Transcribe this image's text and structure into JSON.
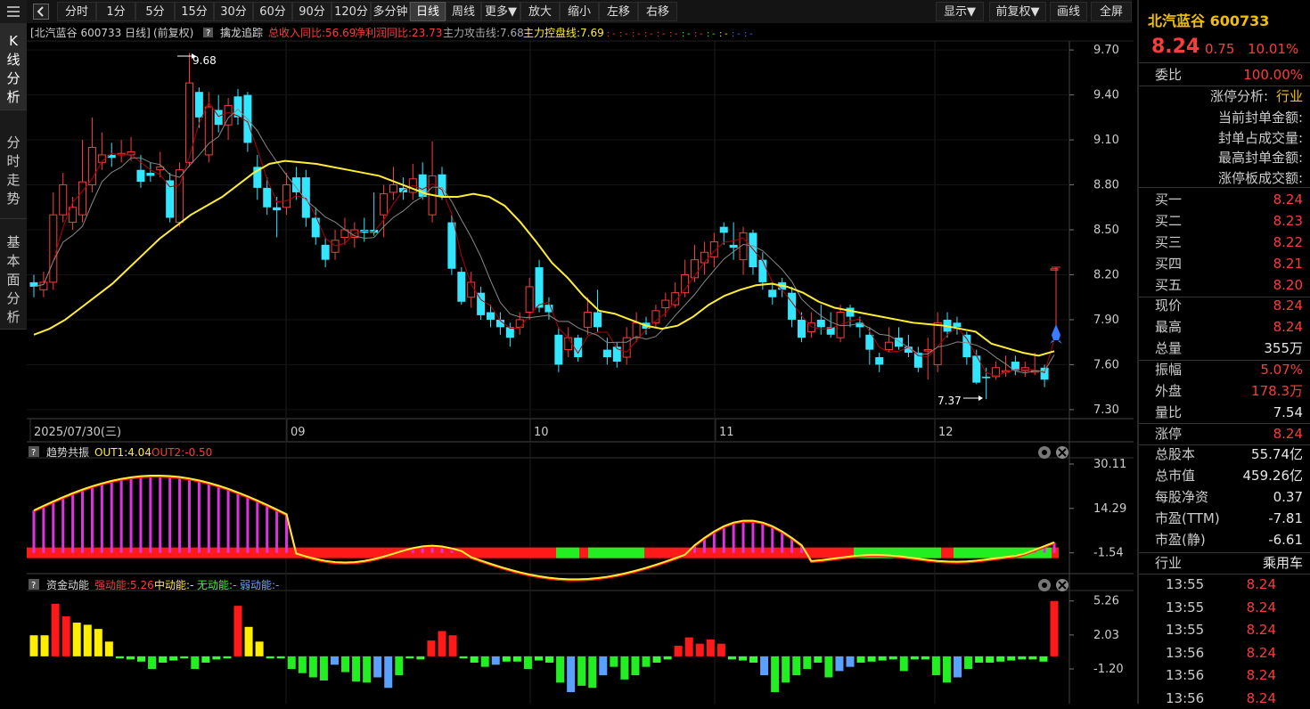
{
  "toolbar": {
    "buttons": [
      "分时",
      "1分",
      "5分",
      "15分",
      "30分",
      "60分",
      "90分",
      "120分",
      "多分钟",
      "日线",
      "周线",
      "更多▼",
      "放大",
      "缩小",
      "左移",
      "右移"
    ],
    "right_buttons": [
      "显示▼",
      "前复权▼",
      "画线",
      "全屏"
    ]
  },
  "left_tabs": [
    "K线分析",
    "分时走势",
    "基本面分析"
  ],
  "chart": {
    "header": {
      "name": "[北汽蓝谷 600733 日线]",
      "adj": "(前复权)",
      "tool": "擒龙追踪",
      "revenue": "总收入同比:56.69",
      "profit": "净利润同比:23.73",
      "attack": "主力攻击线:7.68",
      "control": "主力控盘线:7.69"
    },
    "y_ticks": [
      "9.70",
      "9.40",
      "9.10",
      "8.80",
      "8.50",
      "8.20",
      "7.90",
      "7.60",
      "7.30"
    ],
    "x_labels": [
      "2025/07/30(三)",
      "09",
      "10",
      "11",
      "12"
    ],
    "high_label": "9.68",
    "low_label": "7.37",
    "colors": {
      "up": "#ff3b3b",
      "down": "#33e6ff",
      "ma_short": "#b30000",
      "ma_mid": "#888888",
      "ma_long": "#ffee33"
    }
  },
  "chart_data": {
    "type": "candlestick",
    "y_range": [
      7.24,
      9.76
    ],
    "candles": [
      [
        8.15,
        8.12,
        8.2,
        8.05
      ],
      [
        8.1,
        8.15,
        8.22,
        8.05
      ],
      [
        8.15,
        8.6,
        8.75,
        8.1
      ],
      [
        8.6,
        8.8,
        8.88,
        8.55
      ],
      [
        8.55,
        8.65,
        8.72,
        8.5
      ],
      [
        8.6,
        8.82,
        9.1,
        8.55
      ],
      [
        8.8,
        9.05,
        9.25,
        8.75
      ],
      [
        8.95,
        9.0,
        9.15,
        8.9
      ],
      [
        9.0,
        8.98,
        9.08,
        8.92
      ],
      [
        9.0,
        9.01,
        9.1,
        8.95
      ],
      [
        9.0,
        9.02,
        9.12,
        8.96
      ],
      [
        8.9,
        8.82,
        9.0,
        8.78
      ],
      [
        8.88,
        8.86,
        8.95,
        8.82
      ],
      [
        8.9,
        8.92,
        9.02,
        8.85
      ],
      [
        8.83,
        8.58,
        8.88,
        8.55
      ],
      [
        8.55,
        8.9,
        8.95,
        8.52
      ],
      [
        8.95,
        9.48,
        9.68,
        8.92
      ],
      [
        9.42,
        9.25,
        9.45,
        9.18
      ],
      [
        9.0,
        9.32,
        9.42,
        8.95
      ],
      [
        9.3,
        9.2,
        9.4,
        9.15
      ],
      [
        9.2,
        9.33,
        9.38,
        9.1
      ],
      [
        9.39,
        9.25,
        9.44,
        9.2
      ],
      [
        9.4,
        9.08,
        9.42,
        9.02
      ],
      [
        8.92,
        8.78,
        9.0,
        8.7
      ],
      [
        8.78,
        8.65,
        8.85,
        8.6
      ],
      [
        8.65,
        8.63,
        8.72,
        8.45
      ],
      [
        8.65,
        8.8,
        8.88,
        8.6
      ],
      [
        8.85,
        8.75,
        8.92,
        8.7
      ],
      [
        8.85,
        8.58,
        8.9,
        8.52
      ],
      [
        8.58,
        8.45,
        8.65,
        8.4
      ],
      [
        8.4,
        8.3,
        8.45,
        8.25
      ],
      [
        8.35,
        8.43,
        8.5,
        8.3
      ],
      [
        8.45,
        8.5,
        8.58,
        8.4
      ],
      [
        8.45,
        8.5,
        8.55,
        8.38
      ],
      [
        8.5,
        8.48,
        8.58,
        8.42
      ],
      [
        8.5,
        8.48,
        8.75,
        8.46
      ],
      [
        8.6,
        8.74,
        8.8,
        8.45
      ],
      [
        8.75,
        8.8,
        8.92,
        8.7
      ],
      [
        8.78,
        8.75,
        8.85,
        8.7
      ],
      [
        8.75,
        8.84,
        8.94,
        8.7
      ],
      [
        8.87,
        8.72,
        8.95,
        8.7
      ],
      [
        8.6,
        8.86,
        9.09,
        8.55
      ],
      [
        8.87,
        8.72,
        8.92,
        8.7
      ],
      [
        8.55,
        8.24,
        8.6,
        8.2
      ],
      [
        8.22,
        8.02,
        8.25,
        8.0
      ],
      [
        8.05,
        8.15,
        8.22,
        7.98
      ],
      [
        8.08,
        7.93,
        8.12,
        7.9
      ],
      [
        7.95,
        7.9,
        8.0,
        7.85
      ],
      [
        7.9,
        7.85,
        7.95,
        7.8
      ],
      [
        7.85,
        7.78,
        7.88,
        7.72
      ],
      [
        7.85,
        7.9,
        7.95,
        7.8
      ],
      [
        7.95,
        8.12,
        8.18,
        7.9
      ],
      [
        8.25,
        7.98,
        8.3,
        7.95
      ],
      [
        8.0,
        7.95,
        8.05,
        7.9
      ],
      [
        7.8,
        7.6,
        7.85,
        7.55
      ],
      [
        7.7,
        7.78,
        7.85,
        7.65
      ],
      [
        7.78,
        7.65,
        7.8,
        7.62
      ],
      [
        7.85,
        7.95,
        8.05,
        7.8
      ],
      [
        7.95,
        7.85,
        8.1,
        7.82
      ],
      [
        7.7,
        7.65,
        7.78,
        7.6
      ],
      [
        7.72,
        7.62,
        7.75,
        7.58
      ],
      [
        7.65,
        7.78,
        7.85,
        7.6
      ],
      [
        7.78,
        7.88,
        7.95,
        7.75
      ],
      [
        7.88,
        7.84,
        7.92,
        7.8
      ],
      [
        7.88,
        7.96,
        8.0,
        7.85
      ],
      [
        7.98,
        8.03,
        8.08,
        7.92
      ],
      [
        8.0,
        8.08,
        8.15,
        7.98
      ],
      [
        8.08,
        8.2,
        8.3,
        8.05
      ],
      [
        8.18,
        8.3,
        8.4,
        8.15
      ],
      [
        8.28,
        8.35,
        8.42,
        8.2
      ],
      [
        8.32,
        8.42,
        8.48,
        8.25
      ],
      [
        8.52,
        8.48,
        8.55,
        8.4
      ],
      [
        8.4,
        8.38,
        8.55,
        8.3
      ],
      [
        8.3,
        8.48,
        8.52,
        8.2
      ],
      [
        8.48,
        8.25,
        8.5,
        8.2
      ],
      [
        8.3,
        8.15,
        8.35,
        8.1
      ],
      [
        8.1,
        8.05,
        8.15,
        8.0
      ],
      [
        8.15,
        8.1,
        8.18,
        8.05
      ],
      [
        8.08,
        7.9,
        8.12,
        7.85
      ],
      [
        7.9,
        7.78,
        7.95,
        7.75
      ],
      [
        7.82,
        7.88,
        7.95,
        7.78
      ],
      [
        7.9,
        7.85,
        8.0,
        7.8
      ],
      [
        7.85,
        7.8,
        7.95,
        7.78
      ],
      [
        7.78,
        7.95,
        8.0,
        7.75
      ],
      [
        7.98,
        7.92,
        8.0,
        7.85
      ],
      [
        7.88,
        7.85,
        7.92,
        7.78
      ],
      [
        7.8,
        7.7,
        7.85,
        7.6
      ],
      [
        7.65,
        7.6,
        7.68,
        7.55
      ],
      [
        7.7,
        7.75,
        7.85,
        7.68
      ],
      [
        7.78,
        7.72,
        7.85,
        7.7
      ],
      [
        7.72,
        7.68,
        7.8,
        7.65
      ],
      [
        7.68,
        7.58,
        7.72,
        7.55
      ],
      [
        7.7,
        7.7,
        7.78,
        7.5
      ],
      [
        7.6,
        7.88,
        7.95,
        7.55
      ],
      [
        7.9,
        7.82,
        7.95,
        7.78
      ],
      [
        7.88,
        7.85,
        7.92,
        7.8
      ],
      [
        7.8,
        7.65,
        7.82,
        7.6
      ],
      [
        7.66,
        7.48,
        7.7,
        7.47
      ],
      [
        7.52,
        7.51,
        7.58,
        7.37
      ],
      [
        7.52,
        7.58,
        7.62,
        7.5
      ],
      [
        7.55,
        7.56,
        7.66,
        7.52
      ],
      [
        7.62,
        7.56,
        7.66,
        7.53
      ],
      [
        7.56,
        7.58,
        7.62,
        7.52
      ],
      [
        7.55,
        7.56,
        7.68,
        7.53
      ],
      [
        7.58,
        7.5,
        7.6,
        7.45
      ],
      [
        8.24,
        8.24,
        8.24,
        8.24
      ]
    ],
    "ma_long_points": [
      7.8,
      7.84,
      7.9,
      7.98,
      8.06,
      8.14,
      8.24,
      8.34,
      8.44,
      8.52,
      8.6,
      8.66,
      8.72,
      8.8,
      8.88,
      8.94,
      8.96,
      8.95,
      8.94,
      8.92,
      8.9,
      8.88,
      8.86,
      8.82,
      8.78,
      8.74,
      8.72,
      8.72,
      8.74,
      8.72,
      8.66,
      8.55,
      8.42,
      8.28,
      8.18,
      8.06,
      7.96,
      7.94,
      7.9,
      7.86,
      7.84,
      7.86,
      7.92,
      8.0,
      8.06,
      8.1,
      8.13,
      8.14,
      8.12,
      8.08,
      8.02,
      7.98,
      7.96,
      7.94,
      7.92,
      7.9,
      7.88,
      7.87,
      7.86,
      7.84,
      7.82,
      7.74,
      7.71,
      7.68,
      7.66,
      7.69
    ],
    "indicator1": {
      "title": "趋势共振",
      "out1": "OUT1:4.04",
      "out2": "OUT2:-0.50",
      "y_ticks": [
        "30.11",
        "14.29",
        "-1.54"
      ]
    },
    "indicator2": {
      "title": "资金动能",
      "strong": "强动能:5.26",
      "mid": "中动能:-",
      "none": "无动能:-",
      "weak": "弱动能:-",
      "y_ticks": [
        "5.26",
        "2.03",
        "-1.20"
      ],
      "bars": [
        2.0,
        2.0,
        5.0,
        3.8,
        3.2,
        3.0,
        2.6,
        1.4,
        -0.2,
        -0.3,
        -0.5,
        -1.2,
        -0.6,
        -0.4,
        -0.2,
        -1.2,
        -0.6,
        -0.3,
        -0.2,
        4.8,
        2.8,
        1.4,
        -0.2,
        -0.2,
        -1.2,
        -1.6,
        -2.0,
        -2.3,
        -0.8,
        -1.5,
        -2.4,
        -2.5,
        -2.0,
        -3.0,
        -1.8,
        -0.2,
        -0.3,
        1.5,
        2.4,
        2.0,
        -0.2,
        -0.6,
        -1.0,
        -0.8,
        -0.5,
        -0.5,
        -1.2,
        -0.4,
        -0.6,
        -2.5,
        -3.4,
        -2.8,
        -3.0,
        -1.8,
        -1.0,
        -2.2,
        -1.8,
        -1.0,
        -0.6,
        -0.3,
        1.0,
        1.8,
        1.2,
        1.6,
        1.2,
        -0.3,
        -0.4,
        -0.6,
        -1.8,
        -3.4,
        -2.5,
        -1.8,
        -1.2,
        -0.6,
        -2.0,
        -1.4,
        -1.0,
        -0.6,
        -0.5,
        -0.4,
        -0.3,
        -1.4,
        -0.3,
        -0.3,
        -1.8,
        -2.5,
        -2.0,
        -1.2,
        -0.6,
        -0.6,
        -0.5,
        -0.4,
        -0.3,
        -0.3,
        -0.5,
        5.26
      ]
    }
  },
  "panel": {
    "stock": "北汽蓝谷 600733",
    "price": "8.24",
    "change": "0.75",
    "pct": "10.01%",
    "weibi_label": "委比",
    "weibi_value": "100.00%",
    "limit_label": "涨停分析:",
    "limit_value": "行业",
    "limit_rows": [
      "当前封单金额:",
      "封单占成交量:",
      "最高封单金额:",
      "涨停板成交额:"
    ],
    "bids": [
      [
        "买一",
        "8.24"
      ],
      [
        "买二",
        "8.23"
      ],
      [
        "买三",
        "8.22"
      ],
      [
        "买四",
        "8.21"
      ],
      [
        "买五",
        "8.20"
      ]
    ],
    "stats1": [
      [
        "现价",
        "8.24",
        "red"
      ],
      [
        "最高",
        "8.24",
        "red"
      ],
      [
        "总量",
        "355万",
        "white"
      ]
    ],
    "stats2": [
      [
        "振幅",
        "5.07%",
        "red"
      ],
      [
        "外盘",
        "178.3万",
        "red"
      ],
      [
        "量比",
        "7.54",
        "white"
      ]
    ],
    "stats3": [
      [
        "涨停",
        "8.24",
        "red"
      ]
    ],
    "stats4": [
      [
        "总股本",
        "55.74亿"
      ],
      [
        "总市值",
        "459.26亿"
      ],
      [
        "每股净资",
        "0.37"
      ],
      [
        "市盈(TTM)",
        "-7.81"
      ],
      [
        "市盈(静)",
        "-6.61"
      ]
    ],
    "industry_label": "行业",
    "industry_value": "乘用车",
    "ticks": [
      [
        "13:55",
        "8.24"
      ],
      [
        "13:55",
        "8.24"
      ],
      [
        "13:55",
        "8.24"
      ],
      [
        "13:56",
        "8.24"
      ],
      [
        "13:56",
        "8.24"
      ],
      [
        "13:56",
        "8.24"
      ]
    ]
  }
}
